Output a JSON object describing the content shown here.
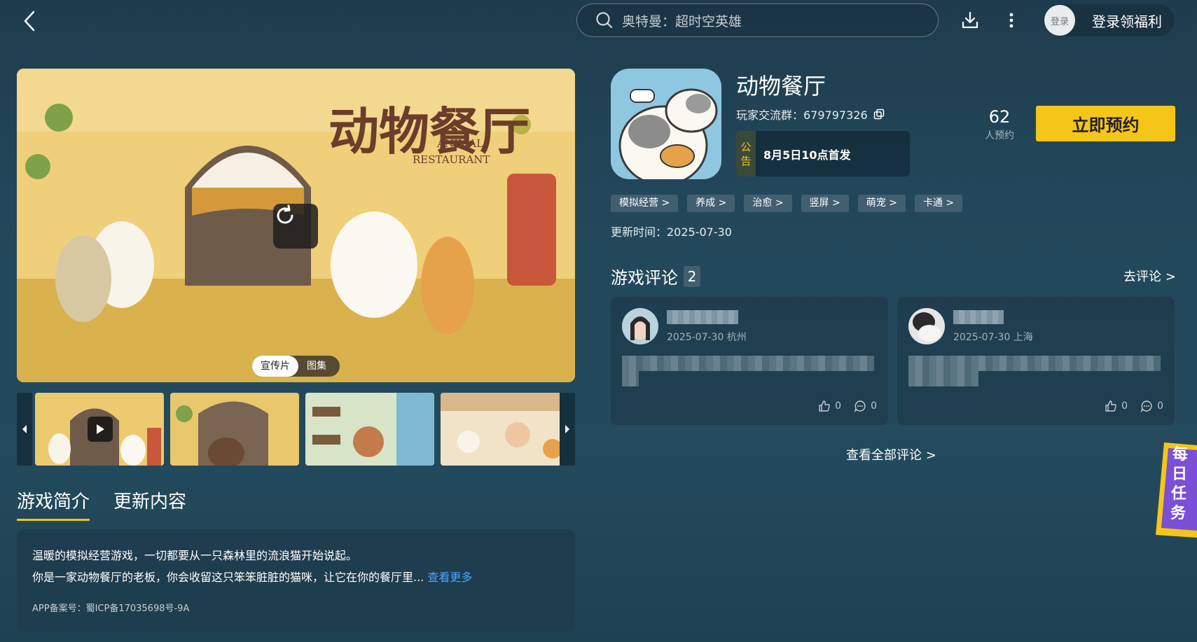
{
  "topbar": {
    "search_placeholder": "奥特曼：超时空英雄",
    "login_avatar_text": "登录",
    "login_label": "登录领福利"
  },
  "media": {
    "hero_title": "动物餐厅",
    "hero_subtitle_line1": "ANIMAL",
    "hero_subtitle_line2": "RESTAURANT",
    "toggle_video": "宣传片",
    "toggle_gallery": "图集"
  },
  "tabs": {
    "intro": "游戏简介",
    "updates": "更新内容"
  },
  "description": {
    "line1": "温暖的模拟经营游戏，一切都要从一只森林里的流浪猫开始说起。",
    "line2": "你是一家动物餐厅的老板，你会收留这只笨笨脏脏的猫咪，让它在你的餐厅里...",
    "more_link": "查看更多",
    "icp": "APP备案号：蜀ICP备17035698号-9A"
  },
  "game": {
    "title": "动物餐厅",
    "qq_group": "玩家交流群：679797326",
    "notice_tag": "公告",
    "notice_tag_c1": "公",
    "notice_tag_c2": "告",
    "notice_text": "8月5日10点首发",
    "reserve_count": "62",
    "reserve_label": "人预约",
    "reserve_button": "立即预约",
    "tags": [
      "模拟经营 >",
      "养成 >",
      "治愈 >",
      "竖屏 >",
      "萌宠 >",
      "卡通 >"
    ],
    "update_time": "更新时间：2025-07-30"
  },
  "reviews": {
    "title": "游戏评论",
    "count": "2",
    "go_comment": "去评论 >",
    "items": [
      {
        "meta": "2025-07-30 杭州",
        "likes": "0",
        "comments": "0"
      },
      {
        "meta": "2025-07-30 上海",
        "likes": "0",
        "comments": "0"
      }
    ],
    "view_all": "查看全部评论 >"
  },
  "daily_task": "每日任务",
  "colors": {
    "accent": "#f5c518",
    "link": "#4aa3ff",
    "background": "#22475a"
  }
}
